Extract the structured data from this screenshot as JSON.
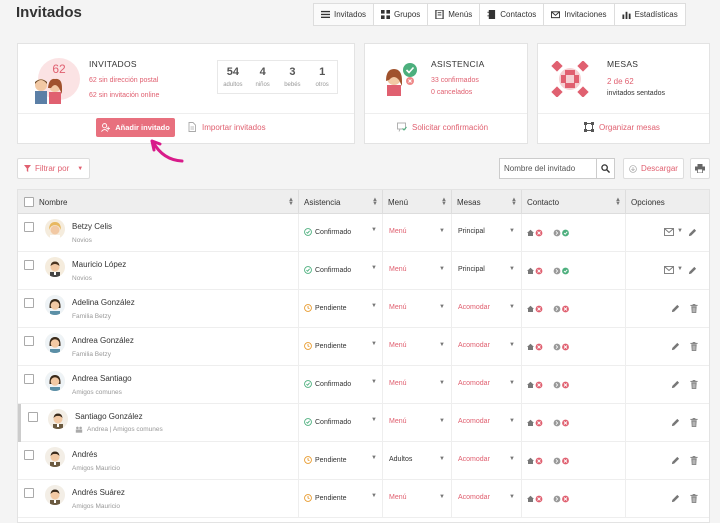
{
  "title": "Invitados",
  "nav": [
    {
      "label": "Invitados",
      "icon": "list-icon",
      "active": true
    },
    {
      "label": "Grupos",
      "icon": "groups-icon"
    },
    {
      "label": "Menús",
      "icon": "menu-book-icon"
    },
    {
      "label": "Contactos",
      "icon": "contacts-icon"
    },
    {
      "label": "Invitaciones",
      "icon": "envelope-icon"
    },
    {
      "label": "Estadísticas",
      "icon": "stats-icon"
    }
  ],
  "guests_card": {
    "title": "INVITADOS",
    "total": "62",
    "no_address": "62 sin dirección postal",
    "no_online": "62 sin invitación online",
    "stats": [
      {
        "value": "54",
        "label": "adultos"
      },
      {
        "value": "4",
        "label": "niños"
      },
      {
        "value": "3",
        "label": "bebés"
      },
      {
        "value": "1",
        "label": "otros"
      }
    ],
    "add_label": "Añadir invitado",
    "import_label": "Importar invitados"
  },
  "attendance_card": {
    "title": "ASISTENCIA",
    "confirmed": "33 confirmados",
    "cancelled": "0 cancelados",
    "action": "Solicitar confirmación"
  },
  "tables_card": {
    "title": "MESAS",
    "ratio": "2 de 62",
    "seated": "invitados sentados",
    "action": "Organizar mesas"
  },
  "toolbar": {
    "filter": "Filtrar por",
    "search_placeholder": "Nombre del invitado",
    "download": "Descargar"
  },
  "columns": {
    "name": "Nombre",
    "attendance": "Asistencia",
    "menu": "Menú",
    "tables": "Mesas",
    "contact": "Contacto",
    "options": "Opciones"
  },
  "rows": [
    {
      "name": "Betzy Celis",
      "group": "Novios",
      "status": "Confirmado",
      "menu": "Menú",
      "menu_set": false,
      "table": "Principal",
      "table_set": true,
      "contact": "full",
      "options": "mail-edit",
      "avatar": "bride"
    },
    {
      "name": "Mauricio López",
      "group": "Novios",
      "status": "Confirmado",
      "menu": "Menú",
      "menu_set": false,
      "table": "Principal",
      "table_set": true,
      "contact": "full",
      "options": "mail-edit",
      "avatar": "groom"
    },
    {
      "name": "Adelina González",
      "group": "Familia Betzy",
      "status": "Pendiente",
      "menu": "Menú",
      "menu_set": false,
      "table": "Acomodar",
      "table_set": false,
      "contact": "partial",
      "options": "edit-delete",
      "avatar": "woman"
    },
    {
      "name": "Andrea González",
      "group": "Familia Betzy",
      "status": "Pendiente",
      "menu": "Menú",
      "menu_set": false,
      "table": "Acomodar",
      "table_set": false,
      "contact": "partial",
      "options": "edit-delete",
      "avatar": "woman"
    },
    {
      "name": "Andrea Santiago",
      "group": "Amigos comunes",
      "status": "Confirmado",
      "menu": "Menú",
      "menu_set": false,
      "table": "Acomodar",
      "table_set": false,
      "contact": "partial",
      "options": "edit-delete",
      "avatar": "woman"
    },
    {
      "name": "Santiago González",
      "group": "Andrea | Amigos comunes",
      "status": "Confirmado",
      "menu": "Menú",
      "menu_set": false,
      "table": "Acomodar",
      "table_set": false,
      "contact": "partial",
      "options": "edit-delete",
      "avatar": "man",
      "companion": true
    },
    {
      "name": "Andrés",
      "group": "Amigos Mauricio",
      "status": "Pendiente",
      "menu": "Adultos",
      "menu_set": true,
      "table": "Acomodar",
      "table_set": false,
      "contact": "partial",
      "options": "edit-delete",
      "avatar": "man"
    },
    {
      "name": "Andrés Suárez",
      "group": "Amigos Mauricio",
      "status": "Pendiente",
      "menu": "Menú",
      "menu_set": false,
      "table": "Acomodar",
      "table_set": false,
      "contact": "partial",
      "options": "edit-delete",
      "avatar": "man"
    }
  ]
}
